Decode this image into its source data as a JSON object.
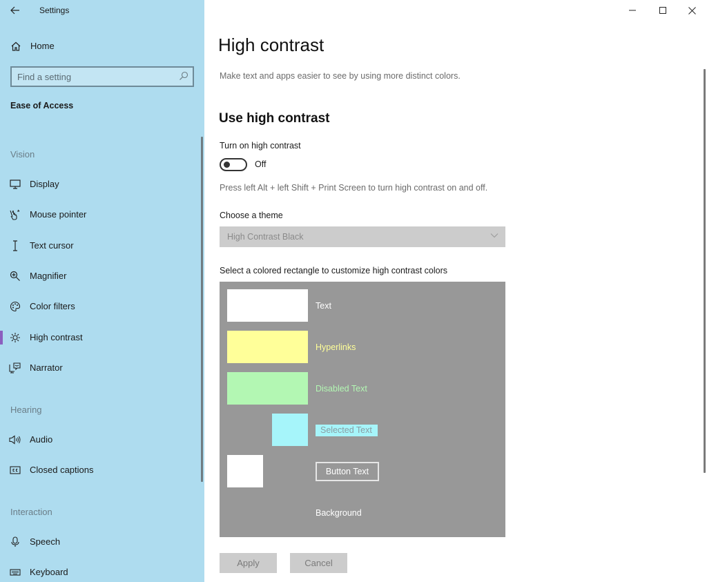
{
  "window": {
    "title": "Settings",
    "controls": {
      "minimize": "minimize-icon",
      "maximize": "maximize-icon",
      "close": "close-icon"
    }
  },
  "sidebar": {
    "home_label": "Home",
    "search_placeholder": "Find a setting",
    "section_title": "Ease of Access",
    "groups": [
      {
        "label": "Vision",
        "items": [
          {
            "label": "Display",
            "icon": "monitor-icon"
          },
          {
            "label": "Mouse pointer",
            "icon": "pointer-hand-icon"
          },
          {
            "label": "Text cursor",
            "icon": "text-cursor-icon"
          },
          {
            "label": "Magnifier",
            "icon": "magnifier-icon"
          },
          {
            "label": "Color filters",
            "icon": "palette-icon"
          },
          {
            "label": "High contrast",
            "icon": "brightness-icon",
            "active": true
          },
          {
            "label": "Narrator",
            "icon": "narrator-icon"
          }
        ]
      },
      {
        "label": "Hearing",
        "items": [
          {
            "label": "Audio",
            "icon": "speaker-icon"
          },
          {
            "label": "Closed captions",
            "icon": "closed-captions-icon"
          }
        ]
      },
      {
        "label": "Interaction",
        "items": [
          {
            "label": "Speech",
            "icon": "microphone-icon"
          },
          {
            "label": "Keyboard",
            "icon": "keyboard-icon"
          }
        ]
      }
    ],
    "accent_color": "#8b5fbf"
  },
  "main": {
    "title": "High contrast",
    "description": "Make text and apps easier to see by using more distinct colors.",
    "section_heading": "Use high contrast",
    "toggle": {
      "label": "Turn on high contrast",
      "state": "Off",
      "on": false
    },
    "shortcut_hint": "Press left Alt + left Shift + Print Screen to turn high contrast on and off.",
    "theme": {
      "label": "Choose a theme",
      "selected": "High Contrast Black"
    },
    "colors": {
      "label": "Select a colored rectangle to customize high contrast colors",
      "panel_color": "#989898",
      "items": [
        {
          "label": "Text",
          "swatch_color": "#ffffff",
          "text_color": "#ffffff"
        },
        {
          "label": "Hyperlinks",
          "swatch_color": "#ffff99",
          "text_color": "#ffff99"
        },
        {
          "label": "Disabled Text",
          "swatch_color": "#b3f7b3",
          "text_color": "#b3f7b3"
        },
        {
          "label": "Selected Text",
          "swatch_color": "#a6f5fa",
          "text_color": "#8a9da3"
        },
        {
          "label": "Button Text",
          "swatch_color": "#ffffff",
          "text_color": "#ffffff"
        },
        {
          "label": "Background",
          "swatch_color": "#989898",
          "text_color": "#ffffff"
        }
      ]
    },
    "buttons": {
      "apply": "Apply",
      "cancel": "Cancel"
    }
  }
}
